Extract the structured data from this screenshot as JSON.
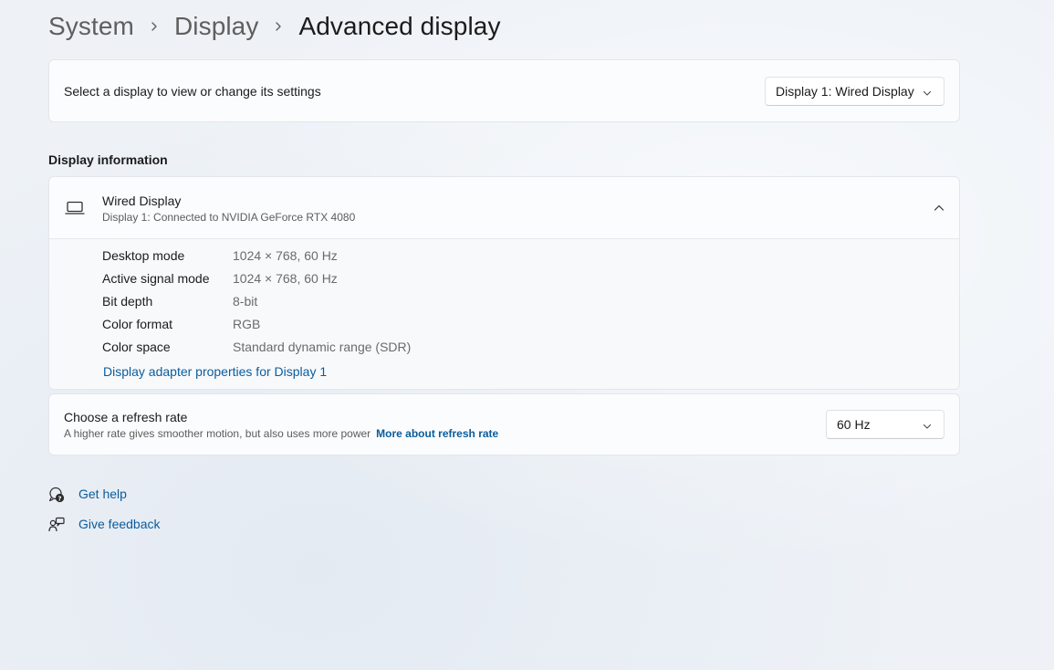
{
  "breadcrumb": {
    "items": [
      "System",
      "Display",
      "Advanced display"
    ]
  },
  "display_select": {
    "label": "Select a display to view or change its settings",
    "selected": "Display 1: Wired Display"
  },
  "display_info": {
    "section_title": "Display information",
    "title": "Wired Display",
    "subtitle": "Display 1: Connected to NVIDIA GeForce RTX 4080",
    "properties": [
      {
        "key": "Desktop mode",
        "value": "1024 × 768, 60 Hz"
      },
      {
        "key": "Active signal mode",
        "value": "1024 × 768, 60 Hz"
      },
      {
        "key": "Bit depth",
        "value": "8-bit"
      },
      {
        "key": "Color format",
        "value": "RGB"
      },
      {
        "key": "Color space",
        "value": "Standard dynamic range (SDR)"
      }
    ],
    "adapter_link": "Display adapter properties for Display 1",
    "icon": "laptop-icon",
    "expanded": true
  },
  "refresh_rate": {
    "title": "Choose a refresh rate",
    "description": "A higher rate gives smoother motion, but also uses more power",
    "link": "More about refresh rate",
    "selected": "60 Hz"
  },
  "help": {
    "get_help": "Get help",
    "give_feedback": "Give feedback"
  },
  "colors": {
    "background": "#eef2f7",
    "card": "#fbfcfd",
    "link": "#0a5c9c",
    "muted_text": "#6b6b6b"
  }
}
